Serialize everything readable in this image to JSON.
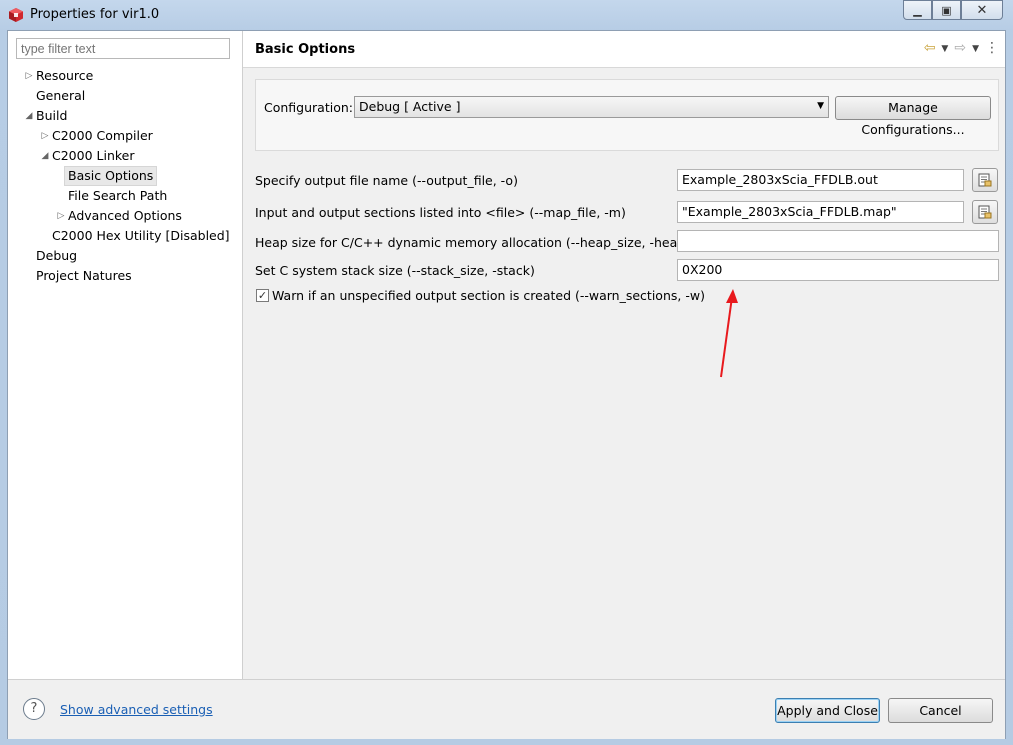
{
  "window": {
    "title": "Properties for vir1.0",
    "controls": [
      "minimize",
      "maximize",
      "close"
    ],
    "colors": {
      "brand_icon": "#d0282e",
      "link": "#1a5fb4",
      "annotation_arrow": "#e8191d"
    }
  },
  "left": {
    "filter": {
      "placeholder": "type filter text",
      "value": ""
    },
    "tree": [
      {
        "label": "Resource",
        "expander": "collapsed"
      },
      {
        "label": "General",
        "expander": "none"
      },
      {
        "label": "Build",
        "expander": "expanded"
      },
      {
        "label": "C2000 Compiler",
        "expander": "collapsed"
      },
      {
        "label": "C2000 Linker",
        "expander": "expanded"
      },
      {
        "label": "Basic Options",
        "expander": "none",
        "selected": true
      },
      {
        "label": "File Search Path",
        "expander": "none"
      },
      {
        "label": "Advanced Options",
        "expander": "collapsed"
      },
      {
        "label": "C2000 Hex Utility  [Disabled]",
        "expander": "none"
      },
      {
        "label": "Debug",
        "expander": "none"
      },
      {
        "label": "Project Natures",
        "expander": "none"
      }
    ]
  },
  "right": {
    "title": "Basic Options",
    "config": {
      "label": "Configuration:",
      "value": "Debug  [ Active ]",
      "manage_label": "Manage Configurations..."
    },
    "options": [
      {
        "label": "Specify output file name (--output_file, -o)",
        "value": "Example_2803xScia_FFDLB.out",
        "browse": true
      },
      {
        "label": "Input and output sections listed into <file> (--map_file, -m)",
        "value": "\"Example_2803xScia_FFDLB.map\"",
        "browse": true
      },
      {
        "label": "Heap size for C/C++ dynamic memory allocation (--heap_size, -heap)",
        "value": "",
        "browse": false
      },
      {
        "label": "Set C system stack size (--stack_size, -stack)",
        "value": "0X200",
        "browse": false
      }
    ],
    "warn": {
      "label": "Warn if an unspecified output section is created (--warn_sections, -w)",
      "checked": true
    }
  },
  "footer": {
    "advanced_link": "Show advanced settings",
    "apply_label": "Apply and Close",
    "cancel_label": "Cancel"
  }
}
